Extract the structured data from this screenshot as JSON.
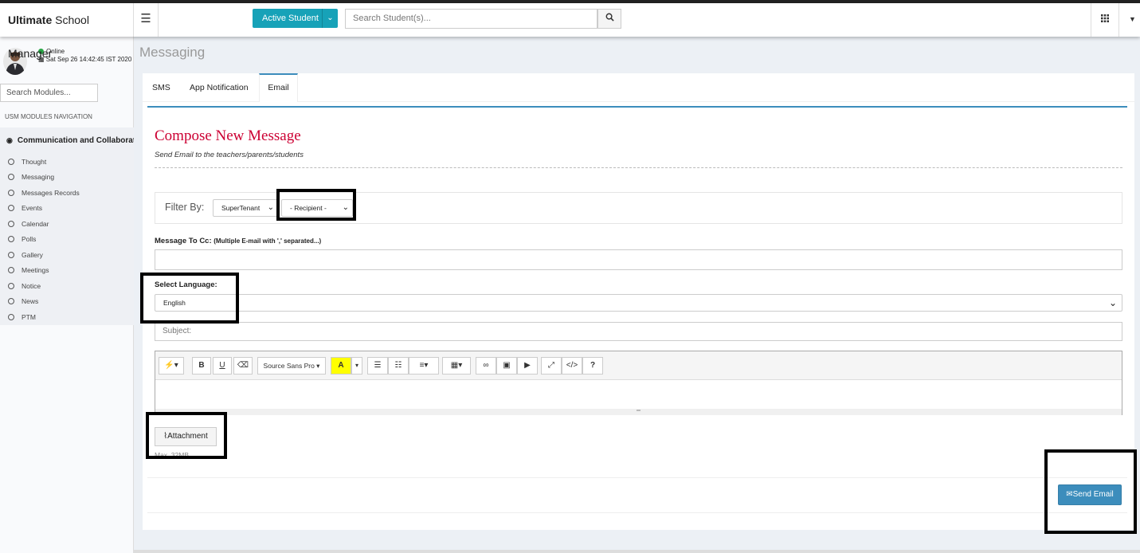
{
  "app": {
    "brand_bold": "Ultimate",
    "brand_rest": " School Manager"
  },
  "header": {
    "active_student_label": "Active Student",
    "search_placeholder": "Search Student(s)..."
  },
  "icons": {
    "menu": "hamburger-icon",
    "search": "search-icon",
    "apps": "grid-icon",
    "user_menu": "caret-down-icon"
  },
  "sidebar": {
    "status": "Online",
    "datetime": "Sat Sep 26 14:42:45 IST 2020",
    "module_search_placeholder": "Search Modules...",
    "nav_heading": "USM MODULES NAVIGATION",
    "group_title": "Communication and Collaborat",
    "items": [
      {
        "label": "Thought"
      },
      {
        "label": "Messaging"
      },
      {
        "label": "Messages Records"
      },
      {
        "label": "Events"
      },
      {
        "label": "Calendar"
      },
      {
        "label": "Polls"
      },
      {
        "label": "Gallery"
      },
      {
        "label": "Meetings"
      },
      {
        "label": "Notice"
      },
      {
        "label": "News"
      },
      {
        "label": "PTM"
      }
    ]
  },
  "page": {
    "title": "Messaging"
  },
  "tabs": [
    {
      "label": "SMS"
    },
    {
      "label": "App Notification"
    },
    {
      "label": "Email",
      "active": true
    }
  ],
  "compose": {
    "title": "Compose New Message",
    "subtitle": "Send Email to the teachers/parents/students",
    "filter_label": "Filter By:",
    "tenant_value": "SuperTenant",
    "recipient_value": "- Recipient -",
    "cc_label": "Message To Cc:",
    "cc_hint": "(Multiple E-mail with ',' separated...)",
    "cc_value": "",
    "language_label": "Select Language:",
    "language_value": "English",
    "subject_placeholder": "Subject:",
    "font_name": "Source Sans Pro",
    "attachment_label": "Attachment",
    "max_size_text": "Max. 32MB",
    "send_label": "Send Email"
  },
  "colors": {
    "accent": "#3c8dbc",
    "teal": "#17a2b8",
    "title_red": "#cc0033"
  }
}
